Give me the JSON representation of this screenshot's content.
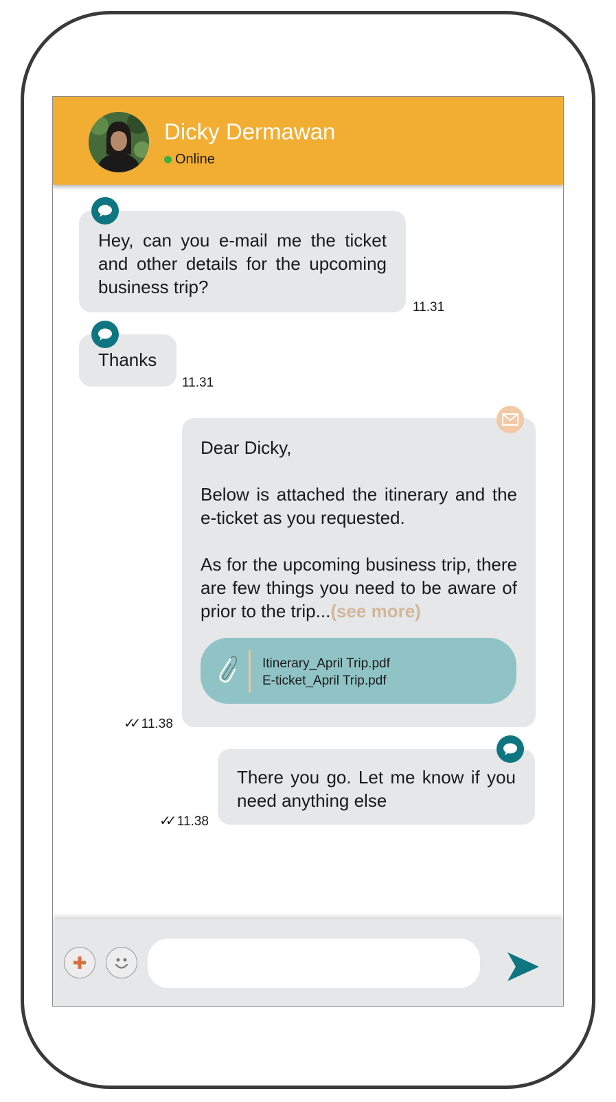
{
  "header": {
    "name": "Dicky Dermawan",
    "status": "Online",
    "colors": {
      "background": "#f1ae33",
      "status_dot": "#3cb043"
    }
  },
  "messages": [
    {
      "direction": "incoming",
      "icon": "chat-bubble-icon",
      "text": "Hey, can you e-mail me the ticket and other details for the upcoming business trip?",
      "time": "11.31"
    },
    {
      "direction": "incoming",
      "icon": "chat-bubble-icon",
      "text": "Thanks",
      "time": "11.31"
    },
    {
      "direction": "outgoing",
      "icon": "mail-icon",
      "type": "email",
      "greeting": "Dear Dicky,",
      "paragraph1": "Below is attached the itinerary and the e-ticket as you requested.",
      "paragraph2": "As for the upcoming business trip, there are few things you need to be aware of prior to the trip...",
      "see_more": "(see more)",
      "attachments": [
        "Itinerary_April Trip.pdf",
        "E-ticket_April Trip.pdf"
      ],
      "time": "11.38",
      "read": true
    },
    {
      "direction": "outgoing",
      "icon": "chat-bubble-icon",
      "text": "There you go. Let me know if you need anything else",
      "time": "11.38",
      "read": true
    }
  ],
  "input_bar": {
    "placeholder": "",
    "buttons": [
      "plus-icon",
      "emoji-icon",
      "send-icon"
    ],
    "colors": {
      "plus": "#d4703f",
      "send": "#0e7680"
    }
  },
  "colors": {
    "bubble": "#e6e7e8",
    "chat_icon": "#0e7680",
    "attachment": "#90c3c5",
    "see_more": "#d2b79b"
  }
}
